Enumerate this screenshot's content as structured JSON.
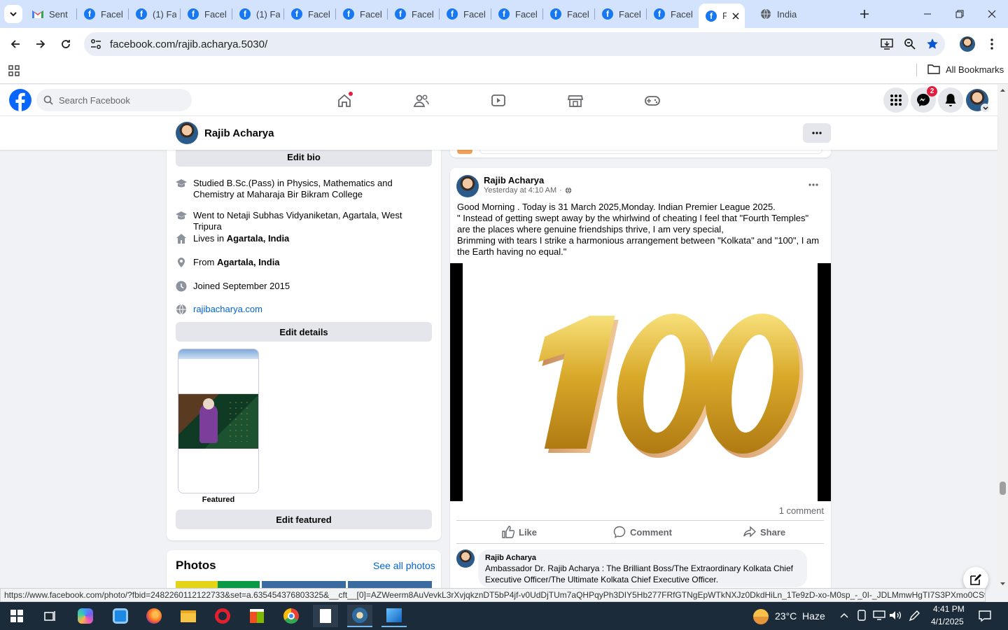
{
  "browser": {
    "tabs": [
      {
        "label": "Sent",
        "kind": "gmail"
      },
      {
        "label": "Facel",
        "kind": "fb"
      },
      {
        "label": "(1) Fa",
        "kind": "fb"
      },
      {
        "label": "Facel",
        "kind": "fb"
      },
      {
        "label": "(1) Fa",
        "kind": "fb"
      },
      {
        "label": "Facel",
        "kind": "fb"
      },
      {
        "label": "Facel",
        "kind": "fb"
      },
      {
        "label": "Facel",
        "kind": "fb"
      },
      {
        "label": "Facel",
        "kind": "fb"
      },
      {
        "label": "Facel",
        "kind": "fb"
      },
      {
        "label": "Facel",
        "kind": "fb"
      },
      {
        "label": "Facel",
        "kind": "fb"
      },
      {
        "label": "Facel",
        "kind": "fb"
      },
      {
        "label": "F",
        "kind": "fb"
      },
      {
        "label": "India",
        "kind": "globe"
      }
    ],
    "url": "facebook.com/rajib.acharya.5030/",
    "bookmarks_label": "All Bookmarks",
    "status_url": "https://www.facebook.com/photo/?fbid=2482260112122733&set=a.635454376803325&__cft__[0]=AZWeerm8AuVevkL3rXvjqkznDT5bP4jf-v0UdDjTUm7aQHPqyPh3DIY5Hb277FRfGTNgEpWTkNXJz0DkdHiLn_1Te9zD-xo-M0sp_-_0I-_JDLMmwHgTI7S3PXmo0CSv96t-..."
  },
  "facebook": {
    "search_placeholder": "Search Facebook",
    "messenger_badge": "2",
    "profile_name": "Rajib Acharya"
  },
  "intro": {
    "edit_bio": "Edit bio",
    "items": [
      {
        "icon": "graduation-cap-icon",
        "text": "Studied B.Sc.(Pass) in Physics, Mathematics and Chemistry at Maharaja Bir Bikram College"
      },
      {
        "icon": "graduation-cap-icon",
        "text": "Went to Netaji Subhas Vidyaniketan, Agartala, West Tripura"
      },
      {
        "icon": "home-icon",
        "prefix": "Lives in ",
        "bold": "Agartala, India"
      },
      {
        "icon": "location-pin-icon",
        "prefix": "From ",
        "bold": "Agartala, India"
      },
      {
        "icon": "clock-icon",
        "text": "Joined September 2015"
      },
      {
        "icon": "globe-icon",
        "link": "rajibacharya.com"
      }
    ],
    "edit_details": "Edit details",
    "featured_label": "Featured",
    "edit_featured": "Edit featured"
  },
  "photos": {
    "title": "Photos",
    "see_all": "See all photos"
  },
  "post": {
    "author": "Rajib Acharya",
    "time": "Yesterday at 4:10 AM",
    "lines": [
      "Good Morning . Today is 31 March 2025,Monday. Indian Premier League 2025.",
      "\" Instead of getting swept away by the whirlwind of cheating I feel that \"Fourth Temples\" are the places where genuine friendships thrive, I am very special,",
      "Brimming with tears I strike a harmonious arrangement between \"Kolkata\" and \"100\", I am the Earth having no equal.\""
    ],
    "image_text": "100",
    "comment_count": "1 comment",
    "like": "Like",
    "comment": "Comment",
    "share": "Share",
    "comment_author": "Rajib Acharya",
    "comment_text": "Ambassador Dr. Rajib Acharya : The Brilliant Boss/The Extraordinary Kolkata Chief Executive Officer/The Ultimate Kolkata Chief Executive Officer."
  },
  "taskbar": {
    "weather": "23°C  Haze",
    "time": "4:41 PM",
    "date": "4/1/2025"
  }
}
